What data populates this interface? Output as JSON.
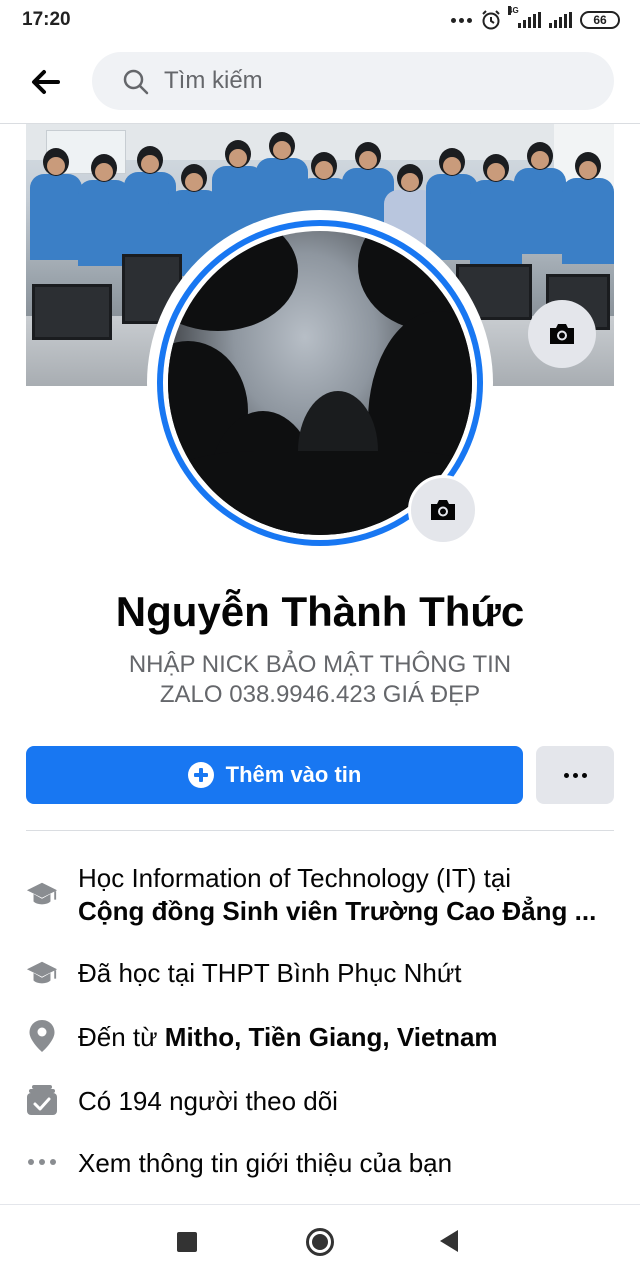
{
  "status_bar": {
    "time": "17:20",
    "network": "4G",
    "battery": "66"
  },
  "search": {
    "placeholder": "Tìm kiếm"
  },
  "profile": {
    "name": "Nguyễn Thành Thức",
    "bio_line1": "NHẬP NICK BẢO MẬT THÔNG TIN",
    "bio_line2": "ZALO 038.9946.423 GIÁ ĐẸP"
  },
  "actions": {
    "add_story_label": "Thêm vào tin"
  },
  "intro": {
    "study_prefix": "Học Information of Technology (IT) tại",
    "study_place": "Cộng đồng Sinh viên Trường Cao Đẳng ...",
    "school": "Đã học tại THPT Bình Phục Nhứt",
    "from_prefix": "Đến từ ",
    "from_place": "Mitho, Tiền Giang, Vietnam",
    "followers": "Có 194 người theo dõi",
    "see_about": "Xem thông tin giới thiệu của bạn"
  },
  "colors": {
    "accent": "#1877f2",
    "secondary_button": "#e4e6eb",
    "muted_text": "#65676b"
  },
  "icons": [
    "back-arrow-icon",
    "search-icon",
    "camera-icon",
    "graduation-cap-icon",
    "location-pin-icon",
    "followers-icon",
    "more-dots-icon"
  ]
}
